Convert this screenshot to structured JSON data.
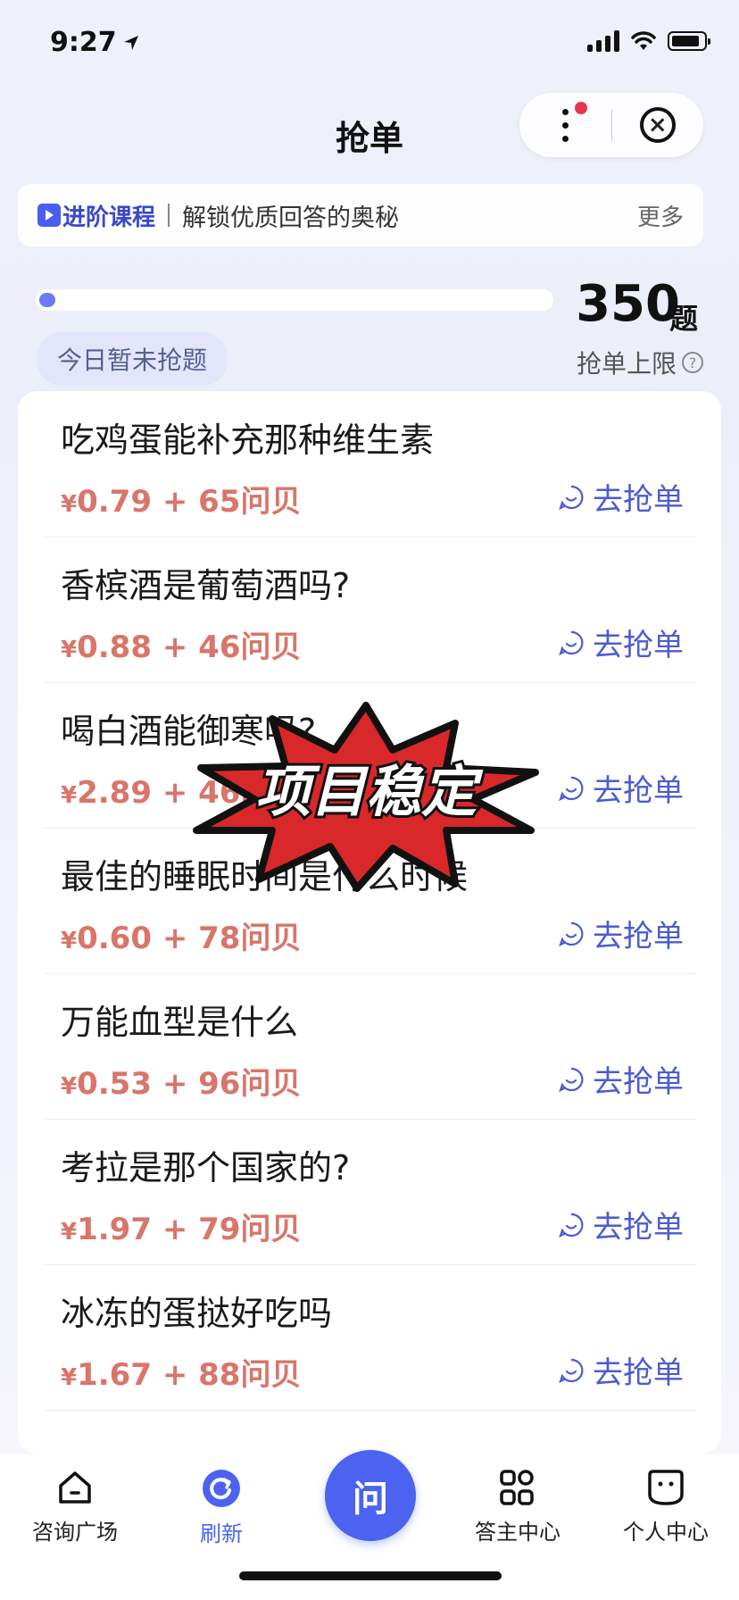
{
  "status_bar": {
    "time": "9:27"
  },
  "header": {
    "title": "抢单"
  },
  "banner": {
    "tag": "进阶课程",
    "text": "解锁优质回答的奥秘",
    "more": "更多"
  },
  "quota": {
    "today_status": "今日暂未抢题",
    "limit_value": "350",
    "limit_unit": "题",
    "limit_label": "抢单上限",
    "progress": 0.0
  },
  "items": [
    {
      "question": "吃鸡蛋能补充那种维生素",
      "price": "0.79 + 65问贝",
      "action": "去抢单"
    },
    {
      "question": "香槟酒是葡萄酒吗?",
      "price": "0.88 + 46问贝",
      "action": "去抢单"
    },
    {
      "question": "喝白酒能御寒吗?",
      "price": "2.89 + 46问贝",
      "action": "去抢单"
    },
    {
      "question": "最佳的睡眠时间是什么时候",
      "price": "0.60 + 78问贝",
      "action": "去抢单"
    },
    {
      "question": "万能血型是什么",
      "price": "0.53 + 96问贝",
      "action": "去抢单"
    },
    {
      "question": "考拉是那个国家的?",
      "price": "1.97 + 79问贝",
      "action": "去抢单"
    },
    {
      "question": "冰冻的蛋挞好吃吗",
      "price": "1.67 + 88问贝",
      "action": "去抢单"
    }
  ],
  "currency_symbol": "¥",
  "overlay_stamp": "项目稳定",
  "tabbar": {
    "tabs": [
      {
        "label": "咨询广场",
        "icon": "home-icon"
      },
      {
        "label": "刷新",
        "icon": "refresh-icon"
      },
      {
        "label": "问",
        "icon": "ask-icon"
      },
      {
        "label": "答主中心",
        "icon": "grid-icon"
      },
      {
        "label": "个人中心",
        "icon": "face-icon"
      }
    ]
  },
  "colors": {
    "accent": "#4b63f0",
    "price": "#d9756a",
    "stamp_red": "#d8282a"
  }
}
